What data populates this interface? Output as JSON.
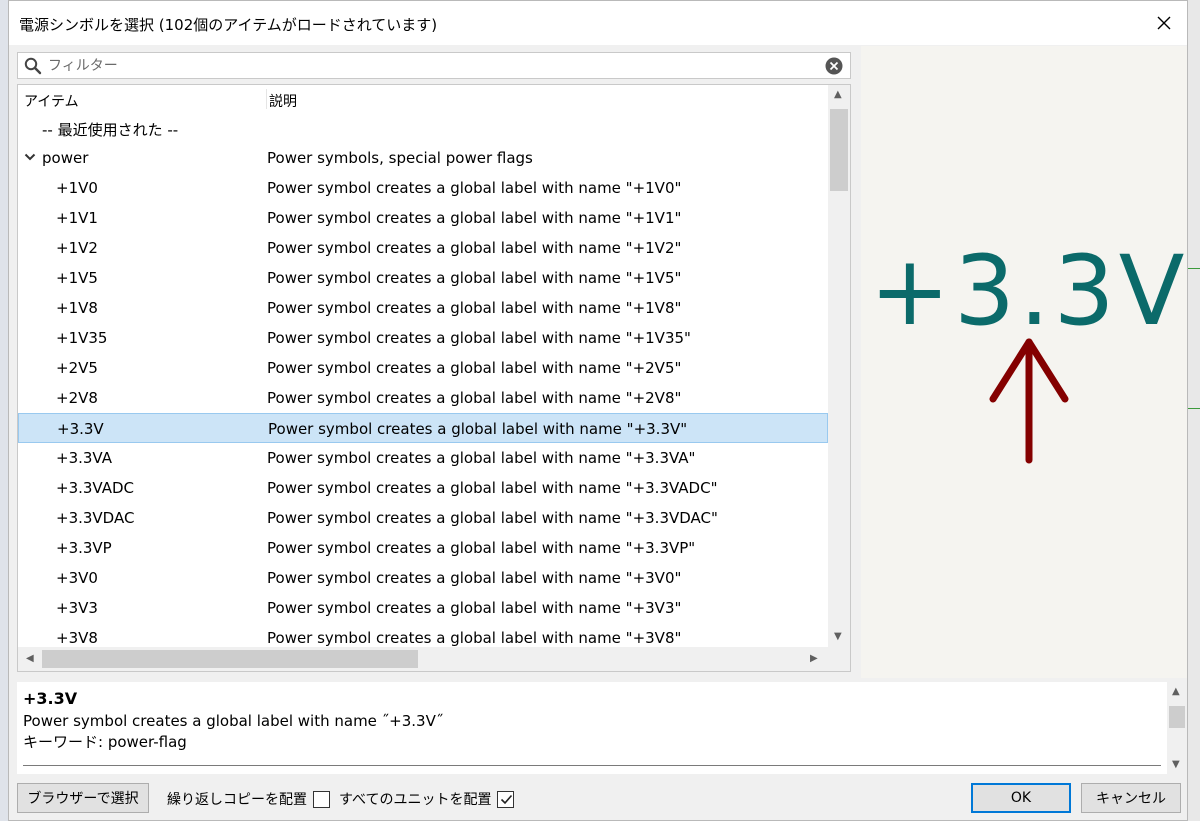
{
  "dialog": {
    "title": "電源シンボルを選択 (102個のアイテムがロードされています)"
  },
  "filter": {
    "placeholder": "フィルター"
  },
  "columns": {
    "item": "アイテム",
    "description": "説明"
  },
  "recent_label": "-- 最近使用された --",
  "group": {
    "name": "power",
    "description": "Power symbols, special power flags"
  },
  "rows": [
    {
      "name": "+1V0",
      "description": "Power symbol creates a global label with name \"+1V0\""
    },
    {
      "name": "+1V1",
      "description": "Power symbol creates a global label with name \"+1V1\""
    },
    {
      "name": "+1V2",
      "description": "Power symbol creates a global label with name \"+1V2\""
    },
    {
      "name": "+1V5",
      "description": "Power symbol creates a global label with name \"+1V5\""
    },
    {
      "name": "+1V8",
      "description": "Power symbol creates a global label with name \"+1V8\""
    },
    {
      "name": "+1V35",
      "description": "Power symbol creates a global label with name \"+1V35\""
    },
    {
      "name": "+2V5",
      "description": "Power symbol creates a global label with name \"+2V5\""
    },
    {
      "name": "+2V8",
      "description": "Power symbol creates a global label with name \"+2V8\""
    },
    {
      "name": "+3.3V",
      "description": "Power symbol creates a global label with name \"+3.3V\"",
      "selected": true
    },
    {
      "name": "+3.3VA",
      "description": "Power symbol creates a global label with name \"+3.3VA\""
    },
    {
      "name": "+3.3VADC",
      "description": "Power symbol creates a global label with name \"+3.3VADC\""
    },
    {
      "name": "+3.3VDAC",
      "description": "Power symbol creates a global label with name \"+3.3VDAC\""
    },
    {
      "name": "+3.3VP",
      "description": "Power symbol creates a global label with name \"+3.3VP\""
    },
    {
      "name": "+3V0",
      "description": "Power symbol creates a global label with name \"+3V0\""
    },
    {
      "name": "+3V3",
      "description": "Power symbol creates a global label with name \"+3V3\""
    },
    {
      "name": "+3V8",
      "description": "Power symbol creates a global label with name \"+3V8\""
    }
  ],
  "preview": {
    "label": "+3.3V",
    "text_color": "#0b6a6a",
    "arrow_color": "#840000"
  },
  "info": {
    "name": "+3.3V",
    "description": "Power symbol creates a global label with name ˝+3.3V˝",
    "keywords": "キーワード: power-flag"
  },
  "buttons": {
    "browse": "ブラウザーで選択",
    "ok": "OK",
    "cancel": "キャンセル"
  },
  "options": {
    "repeat_copy": {
      "label": "繰り返しコピーを配置",
      "checked": false
    },
    "all_units": {
      "label": "すべてのユニットを配置",
      "checked": true
    }
  },
  "colors": {
    "selection": "#cce4f7",
    "ok_border": "#0078d7"
  }
}
